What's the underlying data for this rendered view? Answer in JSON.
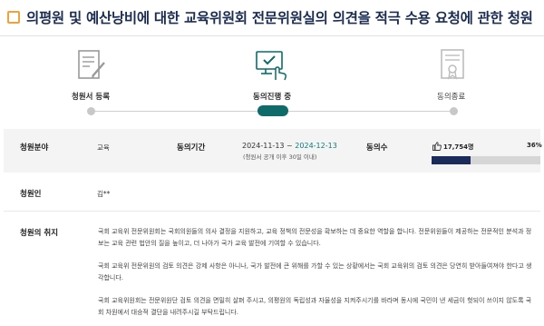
{
  "page": {
    "title": "의평원 및 예산낭비에 대한 교육위원회 전문위원실의 의견을 적극 수용 요청에 관한 청원"
  },
  "steps": [
    {
      "label": "청원서 등록",
      "icon": "form-icon",
      "state": "done"
    },
    {
      "label": "동의진행 중",
      "icon": "computer-check-icon",
      "state": "current"
    },
    {
      "label": "동의종료",
      "icon": "certificate-icon",
      "state": "pending"
    }
  ],
  "info": {
    "field_label": "청원분야",
    "field_value": "교육",
    "period_label": "동의기간",
    "period_start": "2024-11-13",
    "period_sep": " ~ ",
    "period_end": "2024-12-13",
    "period_note": "(청원서 공개 이후 30일 이내)",
    "agree_label": "동의수",
    "agree_count": "17,754명",
    "agree_percent": "36%",
    "agree_fraction": 0.36,
    "petitioner_label": "청원인",
    "petitioner_value": "김**",
    "purpose_label": "청원의 취지",
    "purpose_paragraphs": [
      "국회 교육위 전문위원회는 국회의원들의 의사 결정을 지원하고, 교육 정책의 전문성을 확보하는 데 중요한 역할을 합니다. 전문위원들이 제공하는 전문적인 분석과 정보는 교육 관련 법안의 질을 높이고, 더 나아가 국가 교육 발전에 기여할 수 있습니다.",
      "국회 교육위 전문위원의 검토 의견은 강제 사항은 아니나, 국가 발전에 큰 위해를 가할 수 있는 상황에서는 국회 교육위의 검토 의견은 당연히 받아들여져야 한다고 생각합니다.",
      "국회 교육위원회는 전문위원단 검토 의견을 면밀히 살펴 주시고, 의평원의 독립성과 자율성을 지켜주시기를 바라며 동시에 국민이 낸 세금이 헛되이 쓰이지 않도록 국회 차원에서 대승적 결단을 내려주시길 부탁드립니다."
    ]
  },
  "colors": {
    "title": "#1b2c52",
    "accent_teal": "#0f6a6a",
    "bar_fill": "#1a2a5a",
    "check": "#f0a23a"
  }
}
